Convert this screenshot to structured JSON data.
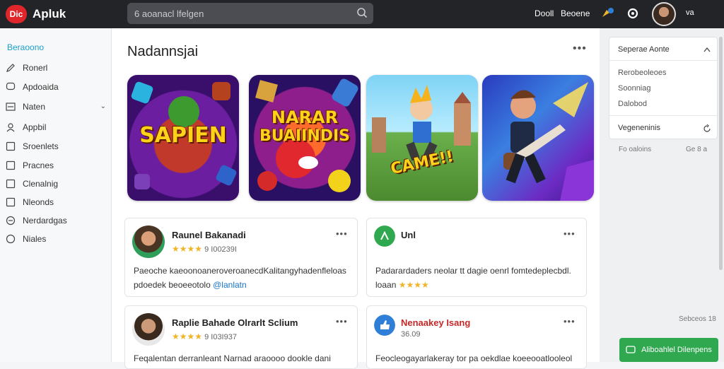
{
  "app": {
    "logo_text": "Dic",
    "brand": "Apluk"
  },
  "search": {
    "placeholder": "6 aoanacl lfelgen"
  },
  "topbar": {
    "link1": "Dooll",
    "link2": "Beoene",
    "extra": "va"
  },
  "sidebar": {
    "heading": "Beraoono",
    "items": [
      {
        "label": "Ronerl",
        "icon": "pencil-icon"
      },
      {
        "label": "Apdoaida",
        "icon": "comment-icon"
      },
      {
        "label": "Naten",
        "icon": "list-icon"
      },
      {
        "label": "Appbil",
        "icon": "user-icon"
      },
      {
        "label": "Sroenlets",
        "icon": "square-icon"
      },
      {
        "label": "Pracnes",
        "icon": "square-icon"
      },
      {
        "label": "Clenalnig",
        "icon": "square-icon"
      },
      {
        "label": "Nleonds",
        "icon": "square-icon"
      },
      {
        "label": "Nerdardgas",
        "icon": "minus-circle-icon"
      },
      {
        "label": "Niales",
        "icon": "circle-icon"
      }
    ]
  },
  "main": {
    "title": "Nadannsjai",
    "tiles": [
      {
        "text": "SAPIEN"
      },
      {
        "text_line1": "NARAR",
        "text_line2": "BUAIINDIS"
      },
      {
        "text": "CAME!!"
      },
      {
        "text": ""
      }
    ],
    "cards": [
      {
        "title": "Raunel Bakanadi",
        "sub": "9 I00239I",
        "stars": "★★★★",
        "body_line1": "Paeoche kaeoonoaneroveroanecdKalitangyhadenfleloas",
        "body_line2": "pdoedek beoeeotolo",
        "mention": "@lanlatn"
      },
      {
        "title": "Unl",
        "sub": "",
        "stars": "★★★★",
        "body_line1": "Padarardaders neolar tt dagie oenrl fomtedeplecbdl.",
        "body_line2": "loaan",
        "mention": ""
      },
      {
        "title": "Raplie Bahade Olrarlt Sclium",
        "sub": "9 I03I937",
        "stars": "★★★★",
        "body_line1": "Feqalentan derranleant Narnad araoooo dookle dani",
        "body_line2": "",
        "mention": ""
      },
      {
        "title": "Nenaakey Isang",
        "sub": "36.09",
        "stars": "",
        "body_line1": "Feocleogayarlakeray tor pa oekdlae koeeooatlooleol",
        "body_line2": "",
        "mention": ""
      }
    ]
  },
  "rightpanel": {
    "header": "Seperae Aonte",
    "items": [
      "Rerobeoleoes",
      "Soonniag",
      "Dalobod"
    ],
    "section": "Vegeneninis",
    "footer_left": "Fo oaloins",
    "footer_right": "Ge 8 a",
    "bottom_note": "Sebceos 18",
    "cta": "Aliboahlel Dilenpens"
  },
  "colors": {
    "accent": "#1aa0c8",
    "brand_red": "#e0262b",
    "cta_green": "#2fa84f",
    "topbar": "#222428"
  }
}
